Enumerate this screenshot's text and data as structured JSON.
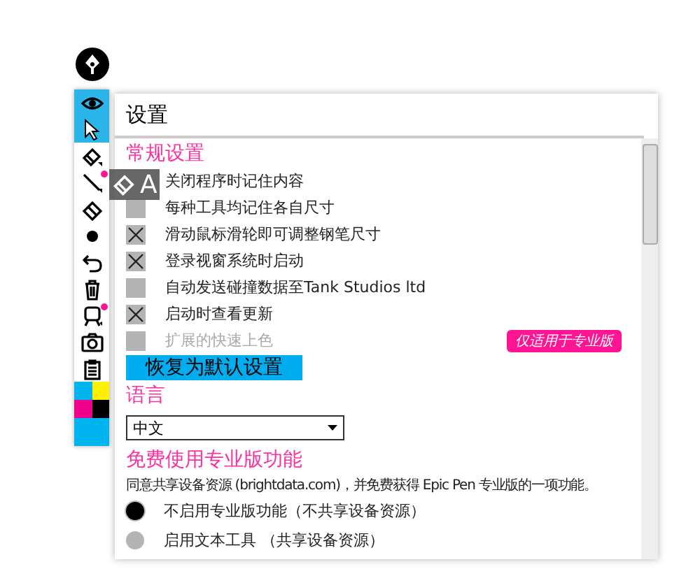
{
  "toolbar": {
    "tools": [
      {
        "kind": "eye",
        "selected": true,
        "marked": false
      },
      {
        "kind": "cursor",
        "selected": true,
        "marked": false
      },
      {
        "kind": "pen",
        "selected": false,
        "marked": false
      },
      {
        "kind": "line",
        "selected": false,
        "marked": true
      },
      {
        "kind": "eraser",
        "selected": false,
        "marked": false
      },
      {
        "kind": "dot",
        "selected": false,
        "marked": false
      },
      {
        "kind": "undo",
        "selected": false,
        "marked": false
      },
      {
        "kind": "trash",
        "selected": false,
        "marked": false
      },
      {
        "kind": "projector",
        "selected": false,
        "marked": true
      },
      {
        "kind": "camera",
        "selected": false,
        "marked": false
      },
      {
        "kind": "clipboard",
        "selected": false,
        "marked": false
      }
    ],
    "colors": [
      {
        "color": "#00b4f0"
      },
      {
        "color": "#fff200"
      },
      {
        "color": "#ec008c"
      },
      {
        "color": "#000000"
      }
    ]
  },
  "flyout": {
    "letter": "A"
  },
  "settings": {
    "title": "设置",
    "general_heading": "常规设置",
    "options": [
      {
        "label": "关闭程序时记住内容",
        "disabled": false
      },
      {
        "label": "每种工具均记住各自尺寸",
        "checked": false,
        "disabled": false
      },
      {
        "label": "滑动鼠标滑轮即可调整钢笔尺寸",
        "checked": true,
        "disabled": false
      },
      {
        "label": "登录视窗系统时启动",
        "checked": true,
        "disabled": false
      },
      {
        "label": "自动发送碰撞数据至Tank Studios ltd",
        "checked": false,
        "disabled": false
      },
      {
        "label": "启动时查看更新",
        "checked": true,
        "disabled": false
      },
      {
        "label": "扩展的快速上色",
        "checked": false,
        "disabled": true,
        "badge": "仅适用于专业版"
      }
    ],
    "reset_button": "恢复为默认设置",
    "language_heading": "语言",
    "language": "中文",
    "pro_heading": "免费使用专业版功能",
    "pro_text": "同意共享设备资源 (brightdata.com)，并免费获得 Epic Pen 专业版的一项功能。",
    "pro_options": [
      {
        "label": "不启用专业版功能（不共享设备资源）",
        "selected": true
      },
      {
        "label": "启用文本工具 （共享设备资源）",
        "selected": false
      }
    ]
  }
}
